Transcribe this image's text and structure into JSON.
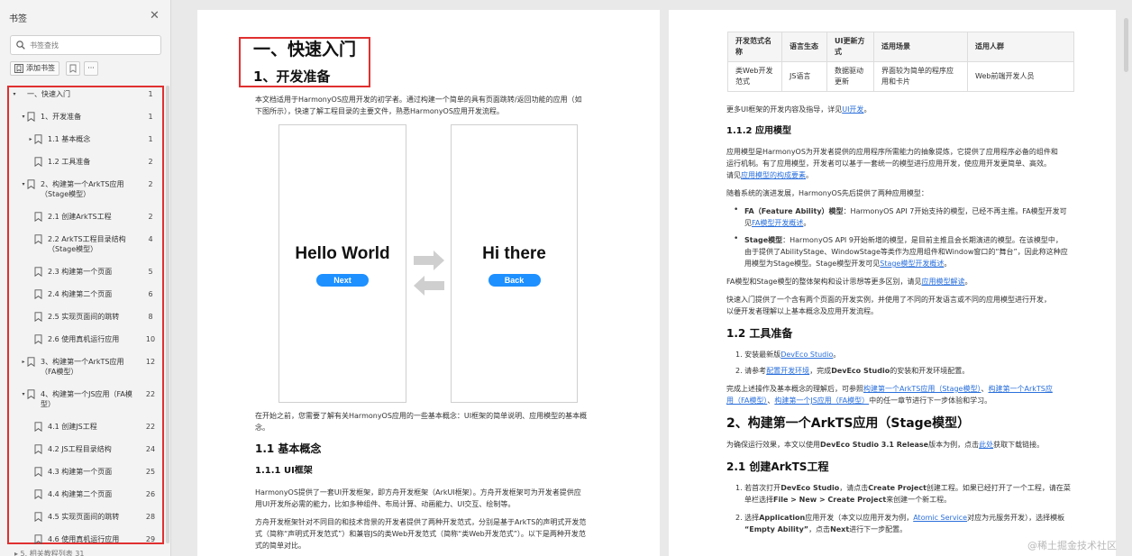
{
  "sidebar": {
    "title": "书签",
    "search_placeholder": "书签查找",
    "add_label": "添加书签",
    "more_label": "···",
    "partial_item": "▸   5. 相关教程列表   31",
    "items": [
      {
        "label": "一、快速入门",
        "page": "1",
        "level": 0,
        "expanded": true,
        "icon": false,
        "lines": 1
      },
      {
        "label": "1、开发准备",
        "page": "1",
        "level": 1,
        "expanded": true,
        "icon": true,
        "lines": 1
      },
      {
        "label": "1.1 基本概念",
        "page": "1",
        "level": 2,
        "expanded": false,
        "icon": true,
        "lines": 1
      },
      {
        "label": "1.2 工具准备",
        "page": "2",
        "level": 2,
        "icon": true,
        "lines": 1
      },
      {
        "label": "2、构建第一个ArkTS应用（Stage模型）",
        "page": "2",
        "level": 1,
        "expanded": true,
        "icon": true,
        "lines": 2
      },
      {
        "label": "2.1 创建ArkTS工程",
        "page": "2",
        "level": 2,
        "icon": true,
        "lines": 1
      },
      {
        "label": "2.2 ArkTS工程目录结构（Stage模型）",
        "page": "4",
        "level": 2,
        "icon": true,
        "lines": 2
      },
      {
        "label": "2.3 构建第一个页面",
        "page": "5",
        "level": 2,
        "icon": true,
        "lines": 1
      },
      {
        "label": "2.4 构建第二个页面",
        "page": "6",
        "level": 2,
        "icon": true,
        "lines": 1
      },
      {
        "label": "2.5 实现页面间的跳转",
        "page": "8",
        "level": 2,
        "icon": true,
        "lines": 1
      },
      {
        "label": "2.6 使用真机运行应用",
        "page": "10",
        "level": 2,
        "icon": true,
        "lines": 1
      },
      {
        "label": "3、构建第一个ArkTS应用（FA模型）",
        "page": "12",
        "level": 1,
        "expanded": false,
        "icon": true,
        "lines": 2
      },
      {
        "label": "4、构建第一个JS应用（FA模型）",
        "page": "22",
        "level": 1,
        "expanded": true,
        "icon": true,
        "lines": 2
      },
      {
        "label": "4.1 创建JS工程",
        "page": "22",
        "level": 2,
        "icon": true,
        "lines": 1
      },
      {
        "label": "4.2 JS工程目录结构",
        "page": "24",
        "level": 2,
        "icon": true,
        "lines": 1
      },
      {
        "label": "4.3 构建第一个页面",
        "page": "25",
        "level": 2,
        "icon": true,
        "lines": 1
      },
      {
        "label": "4.4 构建第二个页面",
        "page": "26",
        "level": 2,
        "icon": true,
        "lines": 1
      },
      {
        "label": "4.5 实现页面间的跳转",
        "page": "28",
        "level": 2,
        "icon": true,
        "lines": 1
      },
      {
        "label": "4.6 使用真机运行应用",
        "page": "29",
        "level": 2,
        "icon": true,
        "lines": 1
      }
    ]
  },
  "page1": {
    "h1": "一、快速入门",
    "h2": "1、开发准备",
    "intro1": "本文档适用于HarmonyOS应用开发的初学者。通过构建一个简单的具有页面跳转/返回功能的应用（如",
    "intro2": "下图所示），快速了解工程目录的主要文件，熟悉HarmonyOS应用开发流程。",
    "hello": "Hello World",
    "next": "Next",
    "hi": "Hi there",
    "back": "Back",
    "before1": "在开始之前，您需要了解有关HarmonyOS应用的一些基本概念：UI框架的简单说明、应用模型的基本概",
    "before2": "念。",
    "h_11": "1.1 基本概念",
    "h_111": "1.1.1 UI框架",
    "ui1": "HarmonyOS提供了一套UI开发框架，即方舟开发框架（ArkUI框架）。方舟开发框架可为开发者提供应",
    "ui2": "用UI开发所必需的能力，比如多种组件、布局计算、动画能力、UI交互、绘制等。",
    "ark1": "方舟开发框架针对不同目的和技术背景的开发者提供了两种开发范式，分别是基于ArkTS的声明式开发范",
    "ark2": "式（简称“声明式开发范式”）和兼容JS的类Web开发范式（简称“类Web开发范式”）。以下是两种开发范",
    "ark3": "式的简单对比。"
  },
  "page2": {
    "table": {
      "headers": [
        "开发范式名称",
        "语言生态",
        "UI更新方式",
        "适用场景",
        "适用人群"
      ],
      "row": [
        "类Web开发范式",
        "JS语言",
        "数据驱动更新",
        "界面较为简单的程序应用和卡片",
        "Web前端开发人员"
      ]
    },
    "more_ui_pre": "更多UI框架的开发内容及指导，详见",
    "more_ui_link": "UI开发",
    "more_ui_post": "。",
    "h_112": "1.1.2 应用模型",
    "am1": "应用模型是HarmonyOS为开发者提供的应用程序所需能力的抽象提炼，它提供了应用程序必备的组件和",
    "am2": "运行机制。有了应用模型，开发者可以基于一套统一的模型进行应用开发，使应用开发更简单、高效。",
    "am3_pre": "请见",
    "am3_link": "应用模型的构成要素",
    "am3_post": "。",
    "evo": "随着系统的演进发展，HarmonyOS先后提供了两种应用模型：",
    "fa_bold": "FA（Feature Ability）模型",
    "fa_text": "：HarmonyOS API 7开始支持的模型，已经不再主推。FA模型开发可",
    "fa2_pre": "见",
    "fa2_link": "FA模型开发概述",
    "fa2_post": "。",
    "st_bold": "Stage模型",
    "st_text": "：HarmonyOS API 9开始新增的模型，是目前主推且会长期演进的模型。在该模型中，",
    "st2": "由于提供了AbilityStage、WindowStage等类作为应用组件和Window窗口的“舞台”，因此称这种应",
    "st3_pre": "用模型为Stage模型。Stage模型开发可见",
    "st3_link": "Stage模型开发概述",
    "st3_post": "。",
    "diff_pre": "FA模型和Stage模型的整体架构和设计思想等更多区别，请见",
    "diff_link": "应用模型解读",
    "diff_post": "。",
    "qs1": "快速入门提供了一个含有两个页面的开发实例，并使用了不同的开发语言或不同的应用模型进行开发，",
    "qs2": "以便开发者理解以上基本概念及应用开发流程。",
    "h_12": "1.2 工具准备",
    "tool1_pre": "1. 安装最新版",
    "tool1_link": "DevEco Studio",
    "tool1_post": "。",
    "tool2_pre": "2. 请参考",
    "tool2_link": "配置开发环境",
    "tool2_mid": "，完成",
    "tool2_bold": "DevEco Studio",
    "tool2_post": "的安装和开发环境配置。",
    "after1_pre": "完成上述操作及基本概念的理解后，可参照",
    "after1_link1": "构建第一个ArkTS应用（Stage模型）",
    "after1_sep": "、",
    "after1_link2": "构建第一个ArkTS应",
    "after2_link2": "用（FA模型）",
    "after2_sep": "、",
    "after2_link3": "构建第一个JS应用（FA模型）",
    "after2_post": "中的任一章节进行下一步体验和学习。",
    "h_2": "2、构建第一个ArkTS应用（Stage模型）",
    "ensure_pre": "为确保运行效果，本文以使用",
    "ensure_bold": "DevEco Studio 3.1 Release",
    "ensure_mid": "版本为例，点击",
    "ensure_link": "此处",
    "ensure_post": "获取下载链接。",
    "h_21": "2.1 创建ArkTS工程",
    "c1_pre": "1. 若首次打开",
    "c1_b1": "DevEco Studio",
    "c1_mid": "，请点击",
    "c1_b2": "Create Project",
    "c1_post": "创建工程。如果已经打开了一个工程，请在菜",
    "c2_pre": "单栏选择",
    "c2_b": "File > New > Create Project",
    "c2_post": "来创建一个新工程。",
    "c3_pre": "2. 选择",
    "c3_b": "Application",
    "c3_mid": "应用开发（本文以应用开发为例，",
    "c3_link": "Atomic Service",
    "c3_post": "对应为元服务开发），选择模板",
    "c4_b1": "“Empty Ability”",
    "c4_mid": "，点击",
    "c4_b2": "Next",
    "c4_post": "进行下一步配置。"
  },
  "watermark": "@稀土掘金技术社区"
}
